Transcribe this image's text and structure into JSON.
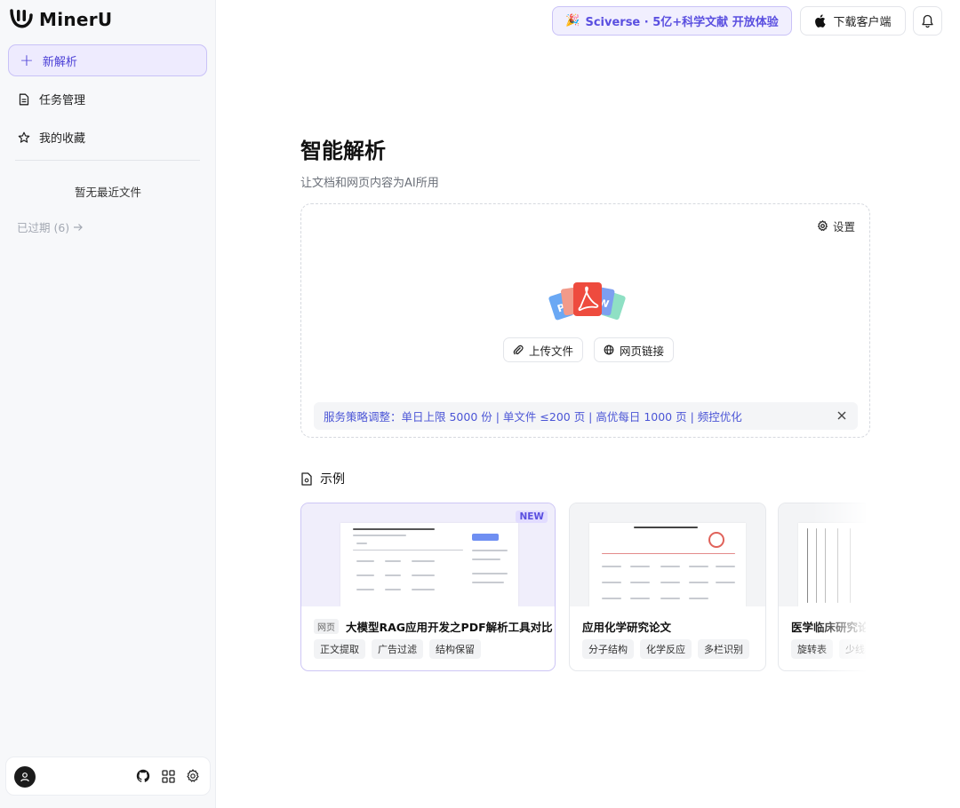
{
  "app": {
    "name": "MinerU"
  },
  "sidebar": {
    "new_parse": "新解析",
    "items": [
      {
        "label": "任务管理",
        "icon": "document-list-icon"
      },
      {
        "label": "我的收藏",
        "icon": "star-icon"
      }
    ],
    "empty_recent": "暂无最近文件",
    "expired": "已过期 (6)"
  },
  "topbar": {
    "promo_emoji": "🎉",
    "promo_text": "Sciverse · 5亿+科学文献 开放体验",
    "download": "下载客户端"
  },
  "main": {
    "title": "智能解析",
    "subtitle": "让文档和网页内容为AI所用",
    "settings": "设置",
    "upload_file": "上传文件",
    "web_link": "网页链接",
    "notice": "服务策略调整：单日上限 5000 份 | 单文件 ≤200 页 | 高优每日 1000 页 | 频控优化"
  },
  "examples": {
    "heading": "示例",
    "cards": [
      {
        "badge": "NEW",
        "type": "网页",
        "title": "大模型RAG应用开发之PDF解析工具对比",
        "tags": [
          "正文提取",
          "广告过滤",
          "结构保留"
        ]
      },
      {
        "title": "应用化学研究论文",
        "tags": [
          "分子结构",
          "化学反应",
          "多栏识别"
        ]
      },
      {
        "title": "医学临床研究论文",
        "tags": [
          "旋转表",
          "少线表"
        ]
      }
    ]
  },
  "colors": {
    "accent": "#5a4fe0",
    "accent_bg": "#eeebfe",
    "notice_text": "#4b55d6"
  }
}
